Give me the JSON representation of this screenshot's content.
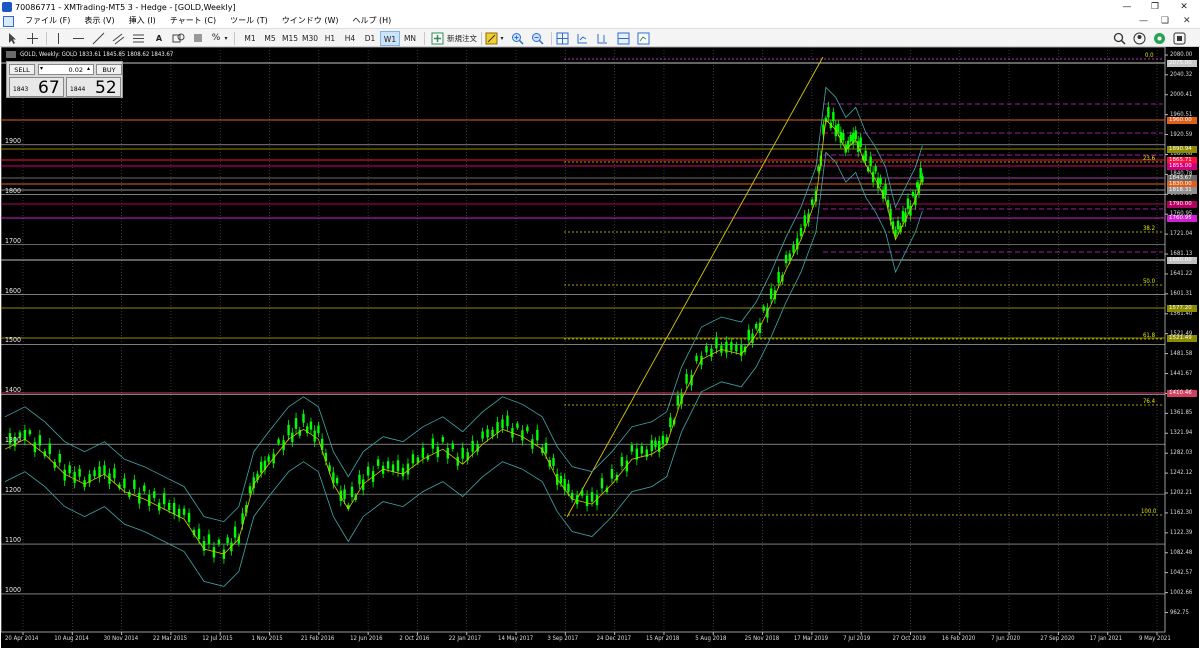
{
  "window": {
    "title": "70086771 - XMTrading-MT5 3 - Hedge - [GOLD,Weekly]"
  },
  "menu": [
    "ファイル (F)",
    "表示 (V)",
    "挿入 (I)",
    "チャート (C)",
    "ツール (T)",
    "ウインドウ (W)",
    "ヘルプ (H)"
  ],
  "toolbar": {
    "timeframes": [
      "M1",
      "M5",
      "M15",
      "M30",
      "H1",
      "H4",
      "D1",
      "W1",
      "MN"
    ],
    "selected_timeframe": "W1",
    "new_order_label": "新規注文"
  },
  "chart": {
    "header": "GOLD, Weekly:  GOLD  1833.61 1845.85 1808.62 1843.67",
    "trade_panel": {
      "sell_label": "SELL",
      "buy_label": "BUY",
      "volume": "0.02",
      "sell_small": "1843",
      "sell_big": "67",
      "buy_small": "1844",
      "buy_big": "52"
    },
    "left_levels": [
      "1900",
      "1800",
      "1700",
      "1600",
      "1500",
      "1400",
      "1300",
      "1200",
      "1100",
      "1000"
    ],
    "right_levels": [
      "2080.00",
      "2040.32",
      "2000.41",
      "1960.51",
      "1920.59",
      "1880.68",
      "1840.78",
      "1800.86",
      "1760.95",
      "1721.04",
      "1681.13",
      "1641.22",
      "1601.31",
      "1561.40",
      "1521.49",
      "1481.58",
      "1441.67",
      "1401.76",
      "1361.85",
      "1321.94",
      "1282.03",
      "1242.12",
      "1202.21",
      "1162.30",
      "1122.39",
      "1082.48",
      "1042.57",
      "1002.66",
      "962.75",
      "922.84"
    ],
    "x_labels": [
      "20 Apr 2014",
      "10 Aug 2014",
      "30 Nov 2014",
      "22 Mar 2015",
      "12 Jul 2015",
      "1 Nov 2015",
      "21 Feb 2016",
      "12 Jun 2016",
      "2 Oct 2016",
      "22 Jan 2017",
      "14 May 2017",
      "3 Sep 2017",
      "24 Dec 2017",
      "15 Apr 2018",
      "5 Aug 2018",
      "25 Nov 2018",
      "17 Mar 2019",
      "7 Jul 2019",
      "27 Oct 2019",
      "16 Feb 2020",
      "7 Jun 2020",
      "27 Sep 2020",
      "17 Jan 2021",
      "9 May 2021"
    ],
    "fib_levels": [
      "0.0",
      "23.6",
      "38.2",
      "50.0",
      "61.8",
      "76.4",
      "100.0"
    ],
    "price_tags": [
      {
        "text": "2075.00",
        "color": "#c8c8c8"
      },
      {
        "text": "1960.00",
        "color": "#e0601a"
      },
      {
        "text": "1890.94",
        "color": "#8c8c00"
      },
      {
        "text": "1865.71",
        "color": "#ff1040"
      },
      {
        "text": "1855.00",
        "color": "#d0007a"
      },
      {
        "text": "1843.67",
        "color": "#6a6a6a"
      },
      {
        "text": "1830.00",
        "color": "#e0601a"
      },
      {
        "text": "1818.31",
        "color": "#909090"
      },
      {
        "text": "1790.00",
        "color": "#b00060"
      },
      {
        "text": "1760.95",
        "color": "#d020d0"
      },
      {
        "text": "1680.00",
        "color": "#c0c0c0"
      },
      {
        "text": "1577.20",
        "color": "#8c8c00"
      },
      {
        "text": "1521.49",
        "color": "#8c8c00"
      },
      {
        "text": "1410.46",
        "color": "#d04060"
      }
    ],
    "colors": {
      "candle": "#00ff00",
      "bollinger": "#3fa8a8",
      "ma": "#d8c800",
      "background": "#000000",
      "fib": "#d8d800",
      "trendline": "#d8c800"
    }
  }
}
